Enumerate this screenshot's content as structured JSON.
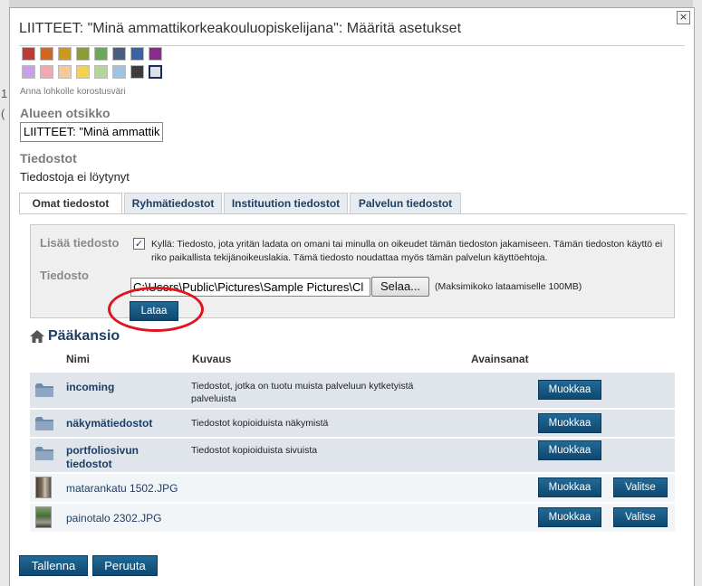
{
  "dialog": {
    "title": "LIITTEET: \"Minä ammattikorkeakouluopiskelijana\": Määritä asetukset",
    "close_symbol": "×"
  },
  "background": {
    "left_chars": [
      "1",
      "("
    ]
  },
  "swatches": {
    "help": "Anna lohkolle korostusväri",
    "row1": [
      "#c13b35",
      "#d2661d",
      "#c99a1e",
      "#8b9e36",
      "#6aa85b",
      "#4b5e80",
      "#3a62a6",
      "#8b2a8d"
    ],
    "row2": [
      "#c9a0e8",
      "#f3a7b2",
      "#f5c898",
      "#f5d24a",
      "#b4d69a",
      "#9ec3e0",
      "#3d3d3d",
      "#dde2e8"
    ],
    "selected_color": "#dde2e8"
  },
  "heading": {
    "label": "Alueen otsikko",
    "value": "LIITTEET: \"Minä ammattik"
  },
  "files": {
    "label": "Tiedostot",
    "empty_text": "Tiedostoja ei löytynyt"
  },
  "tabs": [
    "Omat tiedostot",
    "Ryhmätiedostot",
    "Instituution tiedostot",
    "Palvelun tiedostot"
  ],
  "upload": {
    "add_label": "Lisää tiedosto",
    "license_text": "Kyllä: Tiedosto, jota yritän ladata on omani tai minulla on oikeudet tämän tiedoston jakamiseen. Tämän tiedoston käyttö ei riko paikallista tekijänoikeuslakia. Tämä tiedosto noudattaa myös tämän palvelun käyttöehtoja.",
    "checkbox_mark": "✓",
    "file_label": "Tiedosto",
    "file_path": "C:\\Users\\Public\\Pictures\\Sample Pictures\\Cl",
    "browse": "Selaa...",
    "max_size": "(Maksimikoko lataamiselle 100MB)",
    "upload_button": "Lataa"
  },
  "folder": {
    "title": "Pääkansio",
    "columns": {
      "name": "Nimi",
      "description": "Kuvaus",
      "tags": "Avainsanat"
    }
  },
  "rows": [
    {
      "name": "incoming",
      "description": "Tiedostot, jotka on tuotu muista palveluun kytketyistä palveluista",
      "edit": "Muokkaa"
    },
    {
      "name": "näkymätiedostot",
      "description": "Tiedostot kopioiduista näkymistä",
      "edit": "Muokkaa"
    },
    {
      "name": "portfoliosivun tiedostot",
      "description": "Tiedostot kopioiduista sivuista",
      "edit": "Muokkaa"
    },
    {
      "name": "matarankatu 1502.JPG",
      "description": "",
      "edit": "Muokkaa",
      "select": "Valitse"
    },
    {
      "name": "painotalo 2302.JPG",
      "description": "",
      "edit": "Muokkaa",
      "select": "Valitse"
    }
  ],
  "footer": {
    "save": "Tallenna",
    "cancel": "Peruuta"
  },
  "colors": {
    "accent": "#1e3e66",
    "button": "#1a5e88",
    "highlight": "#e0141c"
  }
}
